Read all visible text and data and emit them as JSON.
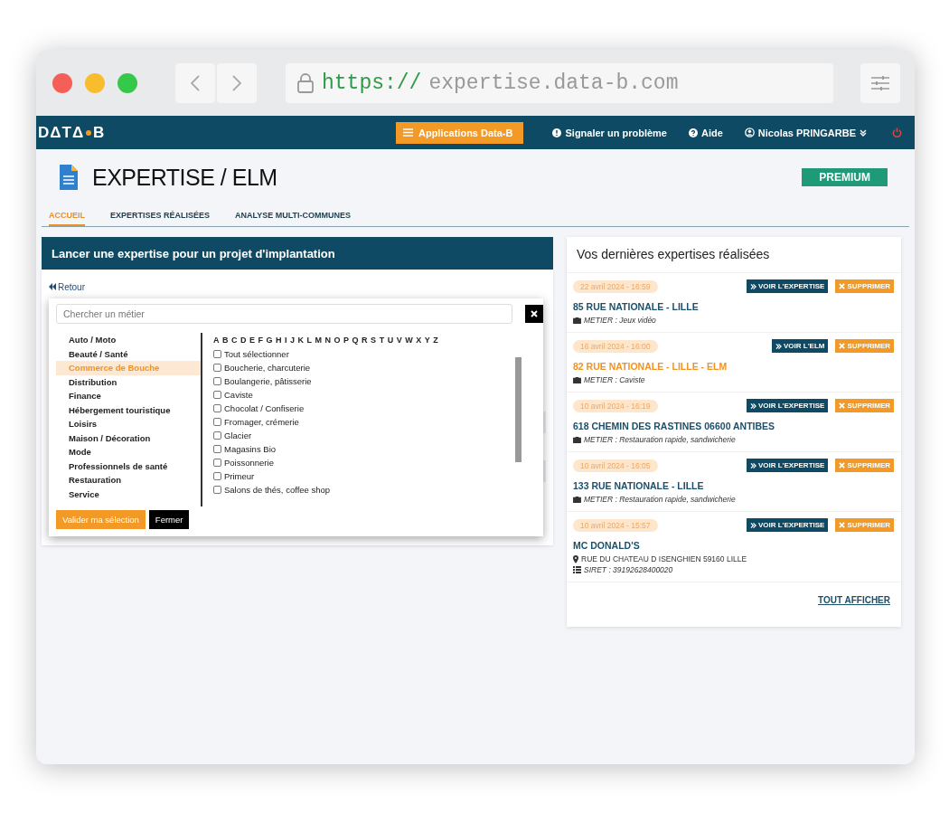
{
  "browser": {
    "url_scheme": "https://",
    "url_host": "expertise.data-b.com"
  },
  "nav": {
    "logo_parts": [
      "DΔTΔ",
      "B"
    ],
    "apps_button": "Applications Data-B",
    "links": [
      {
        "kind": "report",
        "label": "Signaler un problème"
      },
      {
        "kind": "help",
        "label": "Aide"
      },
      {
        "kind": "user",
        "label": "Nicolas PRINGARBE"
      }
    ]
  },
  "header": {
    "title": "EXPERTISE / ELM",
    "badge": "PREMIUM"
  },
  "tabs": [
    {
      "label": "ACCUEIL",
      "selected": true
    },
    {
      "label": "EXPERTISES RÉALISÉES",
      "selected": false
    },
    {
      "label": "ANALYSE MULTI-COMMUNES",
      "selected": false
    }
  ],
  "launch_panel": {
    "title": "Lancer une expertise pour un projet d'implantation",
    "back_link": "Retour"
  },
  "modal": {
    "search": {
      "placeholder": "Chercher un métier"
    },
    "categories": [
      {
        "label": "Auto / Moto",
        "selected": false
      },
      {
        "label": "Beauté / Santé",
        "selected": false
      },
      {
        "label": "Commerce de Bouche",
        "selected": true
      },
      {
        "label": "Distribution",
        "selected": false
      },
      {
        "label": "Finance",
        "selected": false
      },
      {
        "label": "Hébergement touristique",
        "selected": false
      },
      {
        "label": "Loisirs",
        "selected": false
      },
      {
        "label": "Maison / Décoration",
        "selected": false
      },
      {
        "label": "Mode",
        "selected": false
      },
      {
        "label": "Professionnels de santé",
        "selected": false
      },
      {
        "label": "Restauration",
        "selected": false
      },
      {
        "label": "Service",
        "selected": false
      }
    ],
    "letters": [
      "A",
      "B",
      "C",
      "D",
      "E",
      "F",
      "G",
      "H",
      "I",
      "J",
      "K",
      "L",
      "M",
      "N",
      "O",
      "P",
      "Q",
      "R",
      "S",
      "T",
      "U",
      "V",
      "W",
      "X",
      "Y",
      "Z"
    ],
    "jobs": [
      {
        "label": "Tout sélectionner",
        "checked": false
      },
      {
        "label": "Boucherie, charcuterie",
        "checked": false
      },
      {
        "label": "Boulangerie, pâtisserie",
        "checked": false
      },
      {
        "label": "Caviste",
        "checked": false
      },
      {
        "label": "Chocolat / Confiserie",
        "checked": false
      },
      {
        "label": "Fromager, crémerie",
        "checked": false
      },
      {
        "label": "Glacier",
        "checked": false
      },
      {
        "label": "Magasins Bio",
        "checked": false
      },
      {
        "label": "Poissonnerie",
        "checked": false
      },
      {
        "label": "Primeur",
        "checked": false
      },
      {
        "label": "Salons de thés, coffee shop",
        "checked": false
      }
    ],
    "buttons": [
      {
        "kind": "primary",
        "label": "Valider ma sélection"
      },
      {
        "kind": "dark",
        "label": "Fermer"
      }
    ]
  },
  "recent": {
    "title": "Vos dernières expertises réalisées",
    "show_all": "TOUT AFFICHER",
    "items": [
      {
        "kind": "expertise",
        "date": "22 avril 2024 - 16:59",
        "view_button": "VOIR L'EXPERTISE",
        "delete_button": "SUPPRIMER",
        "title": "85 RUE NATIONALE - LILLE",
        "details": [
          {
            "kind": "metier",
            "text": "METIER : Jeux vidéo"
          }
        ]
      },
      {
        "kind": "elm",
        "date": "16 avril 2024 - 16:00",
        "view_button": "VOIR L'ELM",
        "delete_button": "SUPPRIMER",
        "title": "82 RUE NATIONALE - LILLE - ELM",
        "details": [
          {
            "kind": "metier",
            "text": "METIER : Caviste"
          }
        ]
      },
      {
        "kind": "expertise",
        "date": "10 avril 2024 - 16:19",
        "view_button": "VOIR L'EXPERTISE",
        "delete_button": "SUPPRIMER",
        "title": "618 CHEMIN DES RASTINES 06600 ANTIBES",
        "details": [
          {
            "kind": "metier",
            "text": "METIER : Restauration rapide, sandwicherie"
          }
        ]
      },
      {
        "kind": "expertise",
        "date": "10 avril 2024 - 16:05",
        "view_button": "VOIR L'EXPERTISE",
        "delete_button": "SUPPRIMER",
        "title": "133 RUE NATIONALE - LILLE",
        "details": [
          {
            "kind": "metier",
            "text": "METIER : Restauration rapide, sandwicherie"
          }
        ]
      },
      {
        "kind": "expertise",
        "date": "10 avril 2024 - 15:57",
        "view_button": "VOIR L'EXPERTISE",
        "delete_button": "SUPPRIMER",
        "title": "MC DONALD'S",
        "details": [
          {
            "kind": "address",
            "text": "RUE DU CHATEAU D ISENGHIEN 59160 LILLE"
          },
          {
            "kind": "siret",
            "text": "SIRET : 39192628400020"
          }
        ]
      }
    ]
  }
}
